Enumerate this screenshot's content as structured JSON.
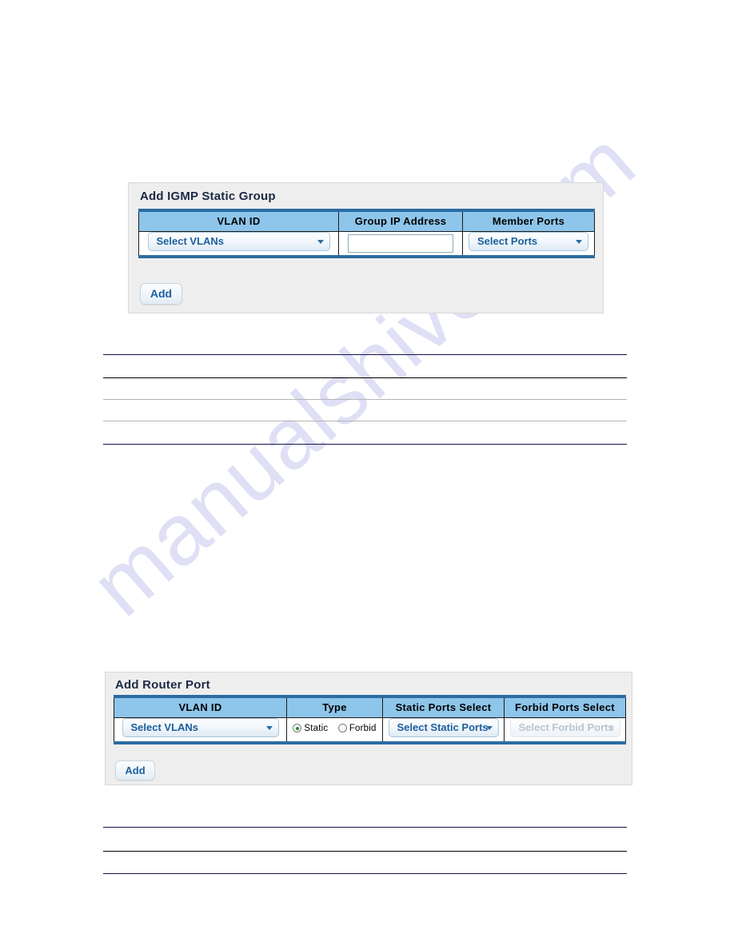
{
  "page": {
    "watermark": "manualshive.com"
  },
  "panel_igmp": {
    "title": "Add IGMP Static Group",
    "columns": [
      "VLAN ID",
      "Group IP Address",
      "Member Ports"
    ],
    "vlan_select": {
      "value": "Select VLANs",
      "caret": "chevron-down-icon"
    },
    "group_ip": {
      "value": "",
      "placeholder": ""
    },
    "member_ports_select": {
      "value": "Select Ports",
      "caret": "chevron-down-icon"
    },
    "add_button": "Add"
  },
  "panel_router_port": {
    "title": "Add Router Port",
    "columns": [
      "VLAN ID",
      "Type",
      "Static Ports Select",
      "Forbid Ports Select"
    ],
    "vlan_select": {
      "value": "Select VLANs",
      "caret": "chevron-down-icon"
    },
    "type_options": [
      {
        "label": "Static",
        "checked": true
      },
      {
        "label": "Forbid",
        "checked": false
      }
    ],
    "static_ports_select": {
      "value": "Select Static Ports",
      "caret": "chevron-down-icon",
      "disabled": false
    },
    "forbid_ports_select": {
      "value": "Select Forbid Ports",
      "caret": "chevron-down-icon",
      "disabled": true
    },
    "add_button": "Add"
  },
  "colors": {
    "header_blue": "#8EC5EA",
    "table_border_blue": "#2B6CA3",
    "panel_bg": "#EEEEEE",
    "link_blue": "#1C5F9E",
    "rule_dark": "#13124A",
    "watermark": "#CCCCF0",
    "radio_green": "#1F8A2E"
  }
}
